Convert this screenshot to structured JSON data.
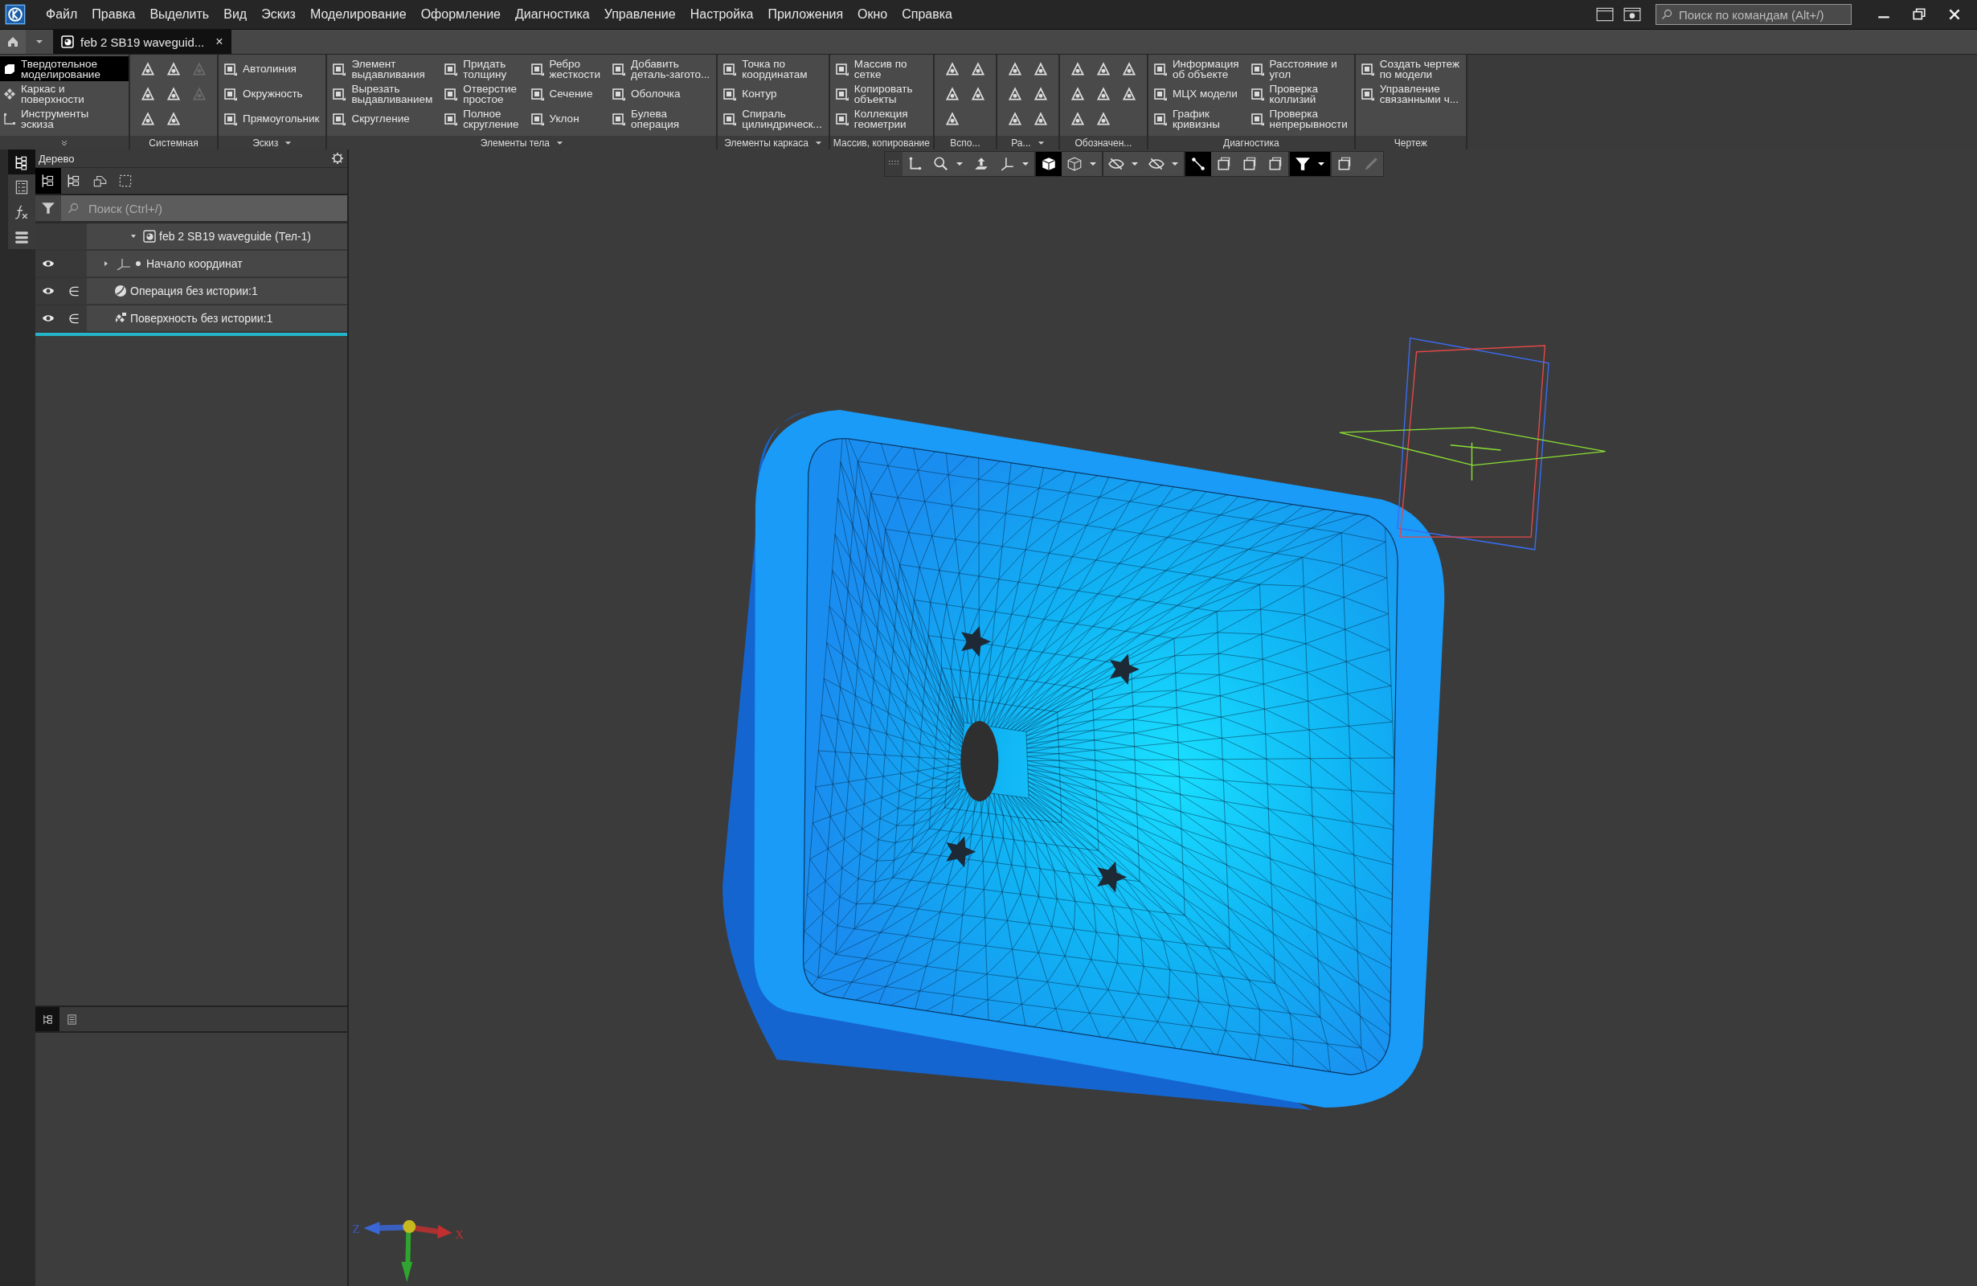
{
  "menu": [
    "Файл",
    "Правка",
    "Выделить",
    "Вид",
    "Эскиз",
    "Моделирование",
    "Оформление",
    "Диагностика",
    "Управление",
    "Настройка",
    "Приложения",
    "Окно",
    "Справка"
  ],
  "command_search": {
    "placeholder": "Поиск по командам (Alt+/)"
  },
  "document_tabs": [
    {
      "label": "feb 2 SB19 waveguid...",
      "selected": true,
      "close": "×"
    }
  ],
  "ribbon": {
    "modes": [
      {
        "label": "Твердотельное\nмоделирование",
        "selected": true
      },
      {
        "label": "Каркас и\nповерхности",
        "selected": false
      },
      {
        "label": "Инструменты\nэскиза",
        "selected": false
      }
    ],
    "groups": [
      {
        "title": "Системная",
        "dropdown": false,
        "kind": "icons",
        "icons": [
          {
            "disabled": false
          },
          {
            "disabled": false
          },
          {
            "disabled": false
          },
          {
            "disabled": false
          },
          {
            "disabled": false
          },
          {
            "disabled": false
          },
          {
            "disabled": true
          },
          {
            "disabled": true
          }
        ]
      },
      {
        "title": "Эскиз",
        "dropdown": true,
        "kind": "commands",
        "commands": [
          "Автолиния",
          "Окружность",
          "Прямоугольник"
        ]
      },
      {
        "title": "Элементы тела",
        "dropdown": true,
        "kind": "commands",
        "commands": [
          "Элемент\nвыдавливания",
          "Вырезать\nвыдавливанием",
          "Скругление",
          "Придать\nтолщину",
          "Отверстие\nпростое",
          "Полное\nскругление",
          "Ребро\nжесткости",
          "Сечение",
          "Уклон",
          "Добавить\nдеталь-загото...",
          "Оболочка",
          "Булева\nоперация"
        ]
      },
      {
        "title": "Элементы каркаса",
        "dropdown": true,
        "kind": "commands",
        "commands": [
          "Точка по\nкоординатам",
          "Контур",
          "Спираль\nцилиндрическ..."
        ]
      },
      {
        "title": "Массив, копирование",
        "dropdown": false,
        "kind": "commands",
        "commands": [
          "Массив по\nсетке",
          "Копировать\nобъекты",
          "Коллекция\nгеометрии"
        ]
      },
      {
        "title": "Вспо...",
        "dropdown": false,
        "kind": "icons",
        "icons": [
          {
            "disabled": false
          },
          {
            "disabled": false
          },
          {
            "disabled": false
          },
          {
            "disabled": false
          },
          {
            "disabled": false
          }
        ]
      },
      {
        "title": "Ра...",
        "dropdown": true,
        "kind": "icons",
        "icons": [
          {
            "disabled": false
          },
          {
            "disabled": false
          },
          {
            "disabled": false
          },
          {
            "disabled": false
          },
          {
            "disabled": false
          },
          {
            "disabled": false
          }
        ]
      },
      {
        "title": "Обозначен...",
        "dropdown": false,
        "kind": "icons",
        "icons": [
          {
            "disabled": false
          },
          {
            "disabled": false
          },
          {
            "disabled": false
          },
          {
            "disabled": false
          },
          {
            "disabled": false
          },
          {
            "disabled": false
          },
          {
            "disabled": false
          },
          {
            "disabled": false
          }
        ]
      },
      {
        "title": "Диагностика",
        "dropdown": false,
        "kind": "commands",
        "commands": [
          "Информация\nоб объекте",
          "МЦХ модели",
          "График\nкривизны",
          "Расстояние и\nугол",
          "Проверка\nколлизий",
          "Проверка\nнепрерывности"
        ]
      },
      {
        "title": "Чертеж",
        "dropdown": false,
        "kind": "commands",
        "commands": [
          "Создать чертеж\nпо модели",
          "Управление\nсвязанными ч..."
        ]
      }
    ]
  },
  "side_rail": [
    {
      "selected": true
    },
    {
      "selected": false
    },
    {
      "selected": false
    },
    {
      "selected": false
    }
  ],
  "tree_panel": {
    "title": "Дерево",
    "toolbar": [
      {
        "selected": true
      },
      {
        "selected": false
      },
      {
        "selected": false
      },
      {
        "selected": false
      }
    ],
    "search": {
      "placeholder": "Поиск (Ctrl+/)"
    },
    "tree": [
      {
        "label": "feb 2 SB19 waveguide (Тел-1)",
        "expanded": true,
        "children": [
          {
            "label": "Начало координат",
            "expanded": false,
            "visible": true
          },
          {
            "label": "Операция без истории:1",
            "visible": true,
            "member": "∈"
          },
          {
            "label": "Поверхность без истории:1",
            "visible": true,
            "member": "∈"
          }
        ]
      }
    ],
    "bottom_tabs": [
      {
        "selected": true
      },
      {
        "selected": false
      }
    ]
  },
  "view_toolbar": [
    {
      "selected": false,
      "dropdown": false,
      "disabled": false
    },
    {
      "selected": false,
      "dropdown": true,
      "disabled": false
    },
    {
      "selected": false,
      "dropdown": false,
      "disabled": false
    },
    {
      "selected": false,
      "dropdown": true,
      "disabled": false
    },
    {
      "selected": true,
      "dropdown": false,
      "disabled": false
    },
    {
      "selected": false,
      "dropdown": true,
      "disabled": false
    },
    {
      "selected": false,
      "dropdown": true,
      "disabled": false
    },
    {
      "selected": false,
      "dropdown": true,
      "disabled": false
    },
    {
      "selected": true,
      "dropdown": false,
      "disabled": false
    },
    {
      "selected": false,
      "dropdown": false,
      "disabled": false
    },
    {
      "selected": false,
      "dropdown": false,
      "disabled": false
    },
    {
      "selected": false,
      "dropdown": false,
      "disabled": false
    },
    {
      "selected": true,
      "dropdown": true,
      "disabled": false
    },
    {
      "selected": false,
      "dropdown": false,
      "disabled": false
    },
    {
      "selected": false,
      "dropdown": false,
      "disabled": true
    }
  ],
  "viewport": {
    "triad_labels": [
      "Z",
      "X"
    ]
  }
}
